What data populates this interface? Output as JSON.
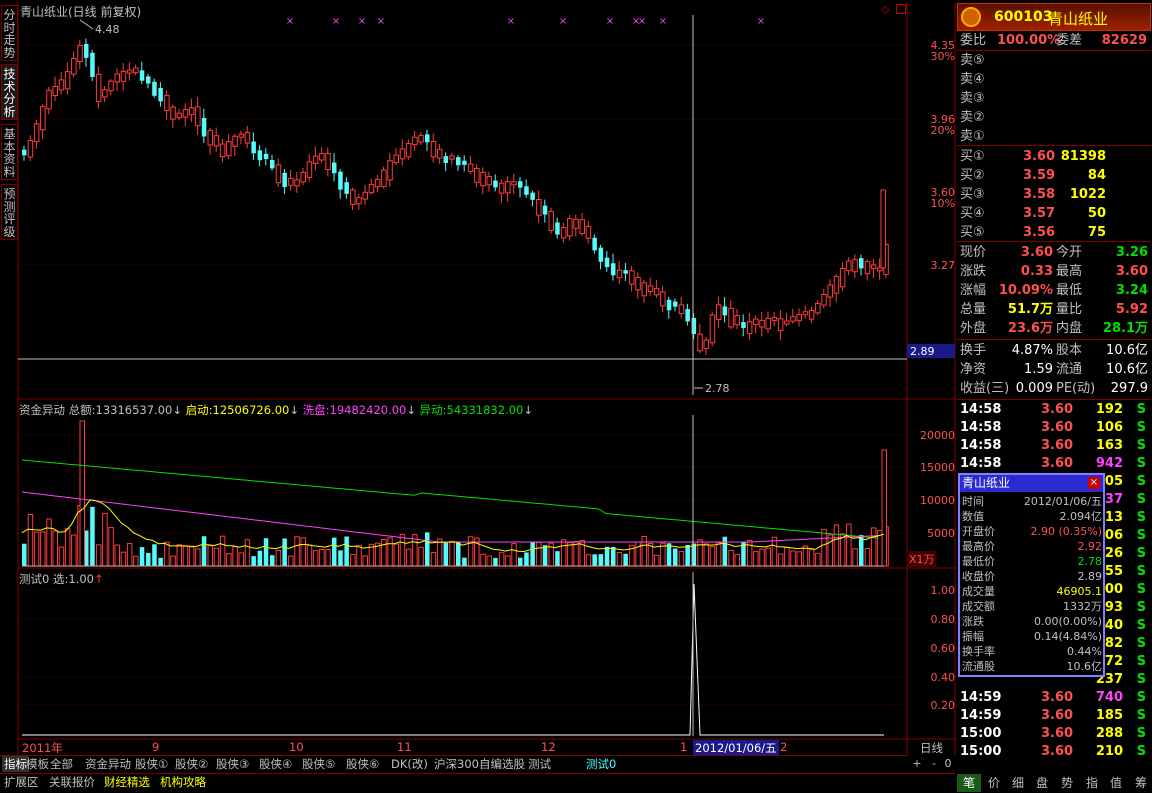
{
  "chart_title": "青山纸业(日线 前复权)",
  "price_axis": {
    "labels": [
      "4.35",
      "30%",
      "3.96",
      "20%",
      "3.60",
      "10%",
      "3.27",
      "2.89"
    ],
    "current": "2.89"
  },
  "price_marks": {
    "high": "4.48",
    "low": "2.78"
  },
  "indicator1": {
    "name": "资金异动",
    "total_label": "总额:",
    "total": "13316537.00",
    "start_label": "启动:",
    "start": "12506726.00",
    "wash_label": "洗盘:",
    "wash": "19482420.00",
    "abn_label": "异动:",
    "abn": "54331832.00",
    "axis": [
      "20000",
      "15000",
      "10000",
      "5000"
    ],
    "unit": "X1万"
  },
  "indicator2": {
    "name": "测试0",
    "sel_label": "选:",
    "sel": "1.00",
    "axis": [
      "1.00",
      "0.80",
      "0.60",
      "0.40",
      "0.20"
    ]
  },
  "date_axis": {
    "labels": [
      "2011年",
      "9",
      "10",
      "11",
      "12",
      "1",
      "2"
    ],
    "cursor": "2012/01/06/五",
    "period": "日线"
  },
  "left_tabs": [
    "分时走势",
    "技术分析",
    "基本资料",
    "预测评级"
  ],
  "bottom_tabs": [
    "指标",
    "模板",
    "全部",
    "资金异动",
    "股侠①",
    "股侠②",
    "股侠③",
    "股侠④",
    "股侠⑤",
    "股侠⑥",
    "DK(改)",
    "沪深300",
    "自编选股",
    "测试",
    "测试0"
  ],
  "bottom_tabs2": [
    "扩展区",
    "关联报价",
    "财经精选",
    "机构攻略"
  ],
  "zoom": [
    "+",
    "-",
    "0"
  ],
  "bottom_icons": [
    "笔",
    "价",
    "细",
    "盘",
    "势",
    "指",
    "值",
    "筹"
  ],
  "quote": {
    "code": "600103",
    "name": "青山纸业",
    "ratio_label": "委比",
    "ratio": "100.00%",
    "diff_label": "委差",
    "diff": "82629",
    "sells": [
      "卖⑤",
      "卖④",
      "卖③",
      "卖②",
      "卖①"
    ],
    "buys": [
      {
        "label": "买①",
        "price": "3.60",
        "vol": "81398"
      },
      {
        "label": "买②",
        "price": "3.59",
        "vol": "84"
      },
      {
        "label": "买③",
        "price": "3.58",
        "vol": "1022"
      },
      {
        "label": "买④",
        "price": "3.57",
        "vol": "50"
      },
      {
        "label": "买⑤",
        "price": "3.56",
        "vol": "75"
      }
    ],
    "stats": [
      {
        "k1": "现价",
        "v1": "3.60",
        "c1": "#ff5050",
        "k2": "今开",
        "v2": "3.26",
        "c2": "#00e000"
      },
      {
        "k1": "涨跌",
        "v1": "0.33",
        "c1": "#ff5050",
        "k2": "最高",
        "v2": "3.60",
        "c2": "#ff5050"
      },
      {
        "k1": "涨幅",
        "v1": "10.09%",
        "c1": "#ff5050",
        "k2": "最低",
        "v2": "3.24",
        "c2": "#00e000"
      },
      {
        "k1": "总量",
        "v1": "51.7万",
        "c1": "#ffff00",
        "k2": "量比",
        "v2": "5.92",
        "c2": "#ff5050"
      },
      {
        "k1": "外盘",
        "v1": "23.6万",
        "c1": "#ff5050",
        "k2": "内盘",
        "v2": "28.1万",
        "c2": "#00e000"
      }
    ],
    "stats2": [
      {
        "k1": "换手",
        "v1": "4.87%",
        "k2": "股本",
        "v2": "10.6亿"
      },
      {
        "k1": "净资",
        "v1": "1.59",
        "k2": "流通",
        "v2": "10.6亿"
      },
      {
        "k1": "收益(三)",
        "v1": "0.009",
        "k2": "PE(动)",
        "v2": "297.9"
      }
    ],
    "ticks": [
      {
        "t": "14:58",
        "p": "3.60",
        "v": "192",
        "c": "#ffff00",
        "s": "S"
      },
      {
        "t": "14:58",
        "p": "3.60",
        "v": "106",
        "c": "#ffff00",
        "s": "S"
      },
      {
        "t": "14:58",
        "p": "3.60",
        "v": "163",
        "c": "#ffff00",
        "s": "S"
      },
      {
        "t": "14:58",
        "p": "3.60",
        "v": "942",
        "c": "#ff40ff",
        "s": "S"
      },
      {
        "t": "",
        "p": "",
        "v": "205",
        "c": "#ffff00",
        "s": "S"
      },
      {
        "t": "",
        "p": "",
        "v": "937",
        "c": "#ff40ff",
        "s": "S"
      },
      {
        "t": "",
        "p": "",
        "v": "413",
        "c": "#ffff00",
        "s": "S"
      },
      {
        "t": "",
        "p": "",
        "v": "206",
        "c": "#ffff00",
        "s": "S"
      },
      {
        "t": "",
        "p": "",
        "v": "326",
        "c": "#ffff00",
        "s": "S"
      },
      {
        "t": "",
        "p": "",
        "v": "155",
        "c": "#ffff00",
        "s": "S"
      },
      {
        "t": "",
        "p": "",
        "v": "200",
        "c": "#ffff00",
        "s": "S"
      },
      {
        "t": "",
        "p": "",
        "v": "193",
        "c": "#ffff00",
        "s": "S"
      },
      {
        "t": "",
        "p": "",
        "v": "440",
        "c": "#ffff00",
        "s": "S"
      },
      {
        "t": "",
        "p": "",
        "v": "182",
        "c": "#ffff00",
        "s": "S"
      },
      {
        "t": "",
        "p": "",
        "v": "72",
        "c": "#ffff00",
        "s": "S"
      },
      {
        "t": "",
        "p": "",
        "v": "237",
        "c": "#ffff00",
        "s": "S"
      },
      {
        "t": "14:59",
        "p": "3.60",
        "v": "740",
        "c": "#ff40ff",
        "s": "S"
      },
      {
        "t": "14:59",
        "p": "3.60",
        "v": "185",
        "c": "#ffff00",
        "s": "S"
      },
      {
        "t": "15:00",
        "p": "3.60",
        "v": "288",
        "c": "#ffff00",
        "s": "S"
      },
      {
        "t": "15:00",
        "p": "3.60",
        "v": "210",
        "c": "#ffff00",
        "s": "S"
      }
    ]
  },
  "tooltip": {
    "title": "青山纸业",
    "rows": [
      {
        "k": "时间",
        "v": "2012/01/06/五",
        "c": "#c0c0c0"
      },
      {
        "k": "数值",
        "v": "2.094亿",
        "c": "#c0c0c0"
      },
      {
        "k": "开盘价",
        "v": "2.90 (0.35%)",
        "c": "#ff5050"
      },
      {
        "k": "最高价",
        "v": "2.92",
        "c": "#ff5050"
      },
      {
        "k": "最低价",
        "v": "2.78",
        "c": "#00e000"
      },
      {
        "k": "收盘价",
        "v": "2.89",
        "c": "#c0c0c0"
      },
      {
        "k": "成交量",
        "v": "46905.1",
        "c": "#ffff00"
      },
      {
        "k": "成交额",
        "v": "1332万",
        "c": "#c0c0c0"
      },
      {
        "k": "涨跌",
        "v": "0.00(0.00%)",
        "c": "#c0c0c0"
      },
      {
        "k": "振幅",
        "v": "0.14(4.84%)",
        "c": "#c0c0c0"
      },
      {
        "k": "换手率",
        "v": "0.44%",
        "c": "#c0c0c0"
      },
      {
        "k": "流通股",
        "v": "10.6亿",
        "c": "#c0c0c0"
      }
    ]
  },
  "colors": {
    "up": "#ff3c3c",
    "down": "#54fcfc",
    "grid": "#800000",
    "axis_text": "#ff5050"
  }
}
